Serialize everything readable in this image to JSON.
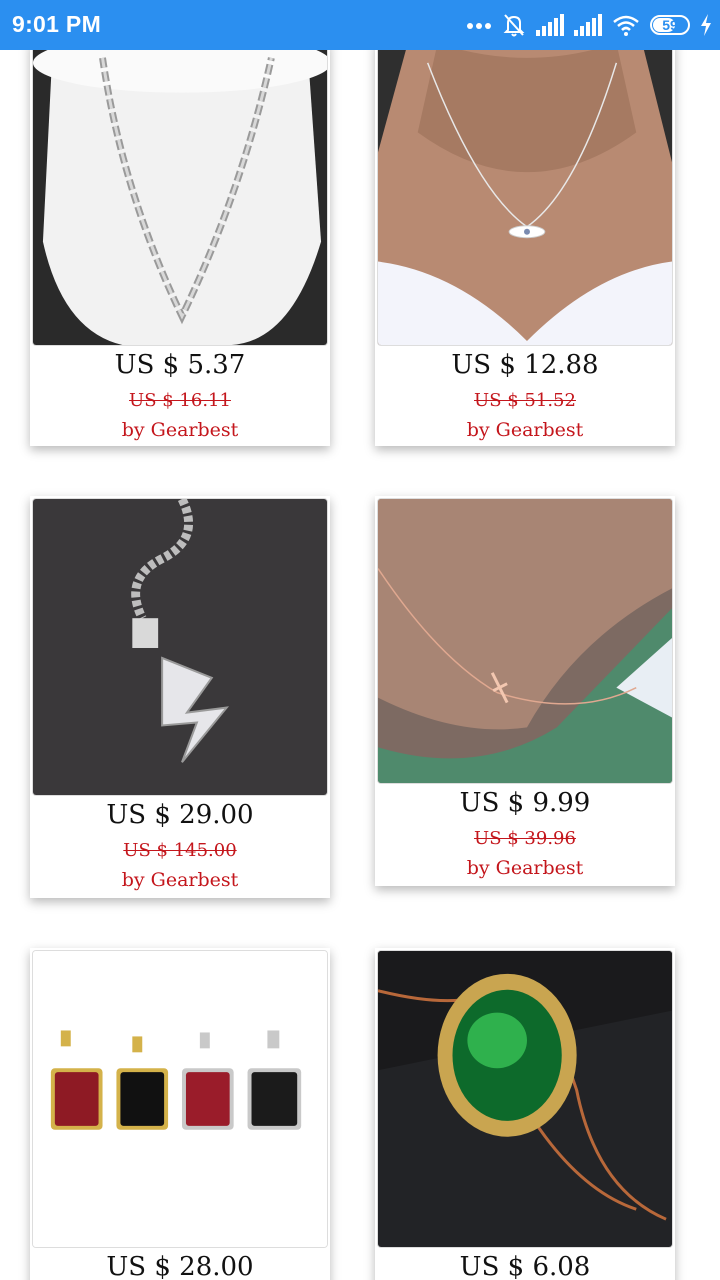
{
  "status_bar": {
    "time": "9:01 PM",
    "battery": "59",
    "icons": [
      "more-dots-icon",
      "alarm-off-icon",
      "signal-icon",
      "signal-icon",
      "wifi-icon",
      "battery-icon",
      "charging-icon"
    ]
  },
  "products": [
    {
      "price": "US $ 5.37",
      "old_price": "US $ 16.11",
      "seller": "by Gearbest",
      "image": "silver-chain-necklace"
    },
    {
      "price": "US $ 12.88",
      "old_price": "US $ 51.52",
      "seller": "by Gearbest",
      "image": "eye-pendant-necklace"
    },
    {
      "price": "US $ 29.00",
      "old_price": "US $ 145.00",
      "seller": "by Gearbest",
      "image": "lightning-bolt-pendant"
    },
    {
      "price": "US $ 9.99",
      "old_price": "US $ 39.96",
      "seller": "by Gearbest",
      "image": "sideways-cross-necklace"
    },
    {
      "price": "US $ 28.00",
      "old_price": "",
      "seller": "",
      "image": "gemstone-pendants"
    },
    {
      "price": "US $ 6.08",
      "old_price": "",
      "seller": "",
      "image": "green-stone-pendant"
    }
  ]
}
